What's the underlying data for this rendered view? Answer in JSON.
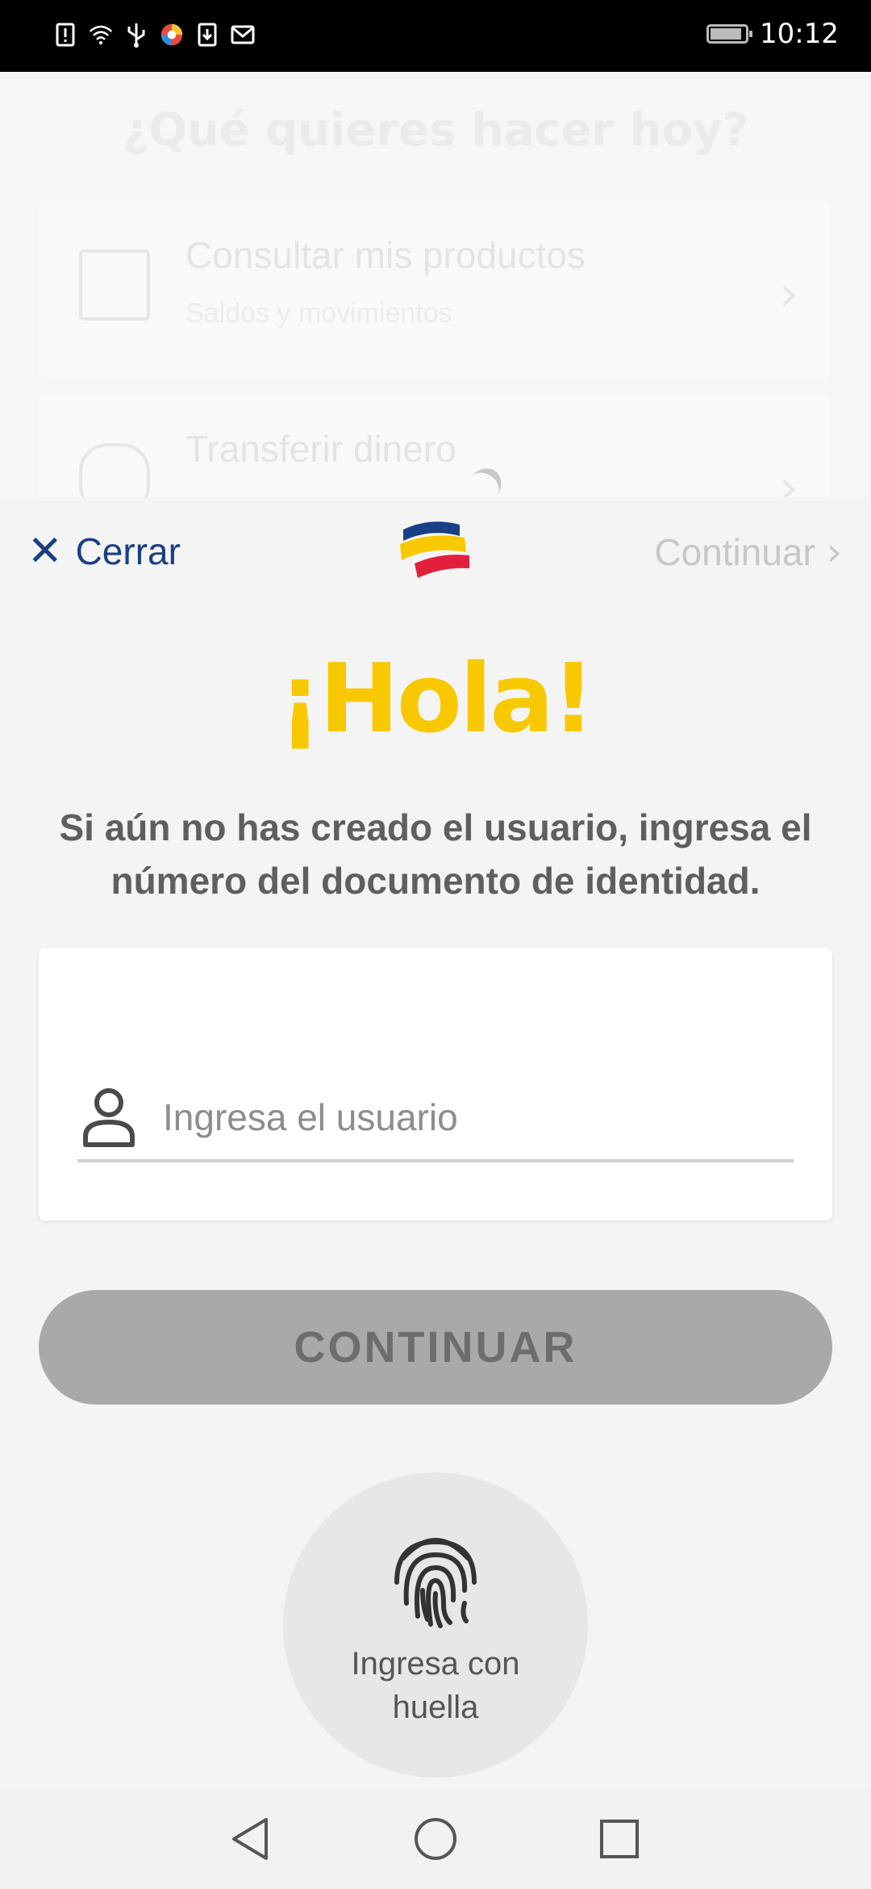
{
  "status_bar": {
    "time": "10:12",
    "icons": [
      "alert-icon",
      "wifi-icon",
      "usb-icon",
      "app-icon",
      "download-icon",
      "mail-icon"
    ],
    "battery": "battery-charging-icon"
  },
  "background": {
    "title": "¿Qué quieres hacer hoy?",
    "cards": [
      {
        "title": "Consultar mis productos",
        "subtitle": "Saldos y movimientos"
      },
      {
        "title": "Transferir dinero",
        "subtitle": ""
      }
    ]
  },
  "header": {
    "close_label": "Cerrar",
    "continue_label": "Continuar"
  },
  "greeting": "¡Hola!",
  "instruction": "Si aún no has creado el usuario, ingresa el número del documento de identidad.",
  "login_form": {
    "user_placeholder": "Ingresa el usuario",
    "user_value": ""
  },
  "continue_button": "CONTINUAR",
  "fingerprint": {
    "label": "Ingresa con huella"
  },
  "colors": {
    "brand_blue": "#1a3f86",
    "brand_yellow": "#f8c900",
    "brand_red": "#e3203b",
    "disabled_button": "#a8a9ab"
  }
}
